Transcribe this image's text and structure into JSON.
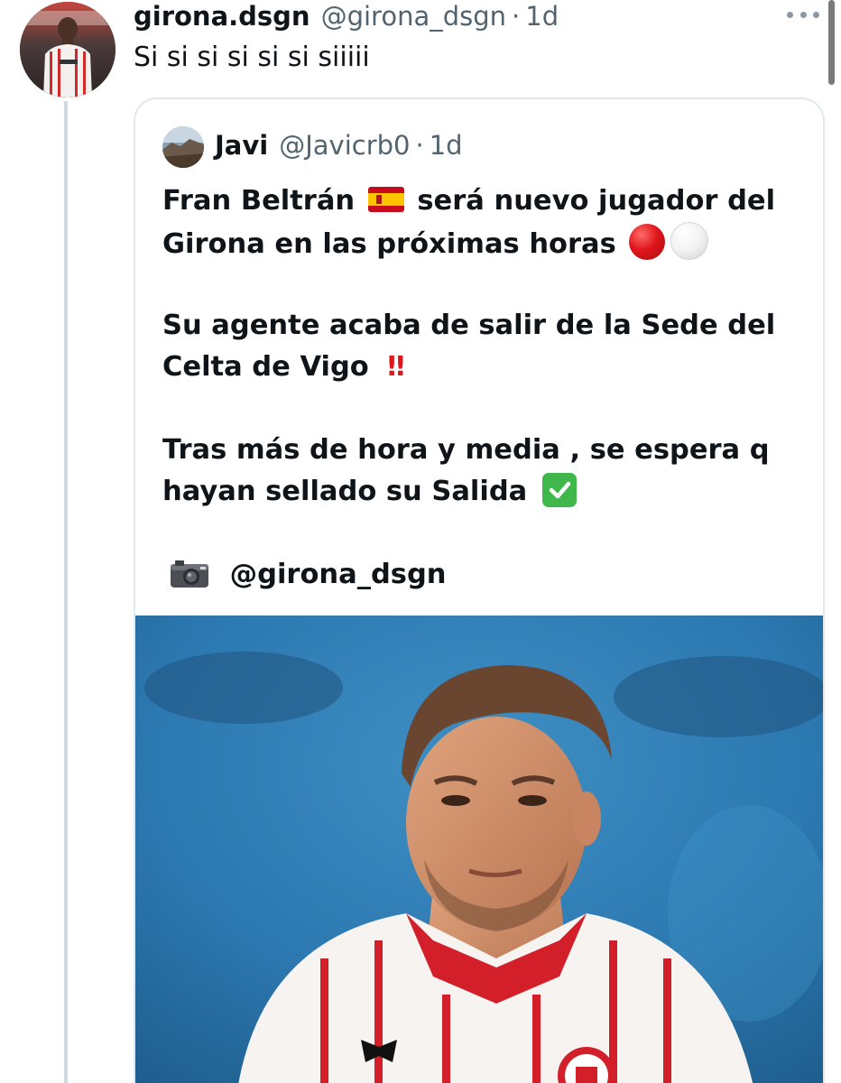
{
  "tweet": {
    "display_name": "girona.dsgn",
    "handle": "@girona_dsgn",
    "separator": "·",
    "time": "1d",
    "text": "Si si si si si si siiiii"
  },
  "quote": {
    "display_name": "Javi",
    "handle": "@Javicrb0",
    "separator": "·",
    "time": "1d",
    "lines": {
      "l1a": "Fran Beltrán",
      "l1b": "será nuevo jugador del",
      "l2": "Girona en las próximas horas",
      "l3": "Su agente acaba de salir de la Sede del",
      "l4": "Celta de Vigo",
      "l5": "Tras más de hora y media , se espera q",
      "l6": "hayan sellado su Salida",
      "l7": "@girona_dsgn"
    },
    "emoji": {
      "flag": "spain-flag",
      "circles": [
        "red-circle",
        "white-circle"
      ],
      "bangs": "‼",
      "check": "check-mark-button",
      "camera": "camera"
    }
  },
  "colors": {
    "text_primary": "#0f1419",
    "text_secondary": "#536471",
    "border": "#e1e8ed",
    "thread_line": "#cfd9de"
  },
  "icons": {
    "more": "more-options-icon"
  }
}
